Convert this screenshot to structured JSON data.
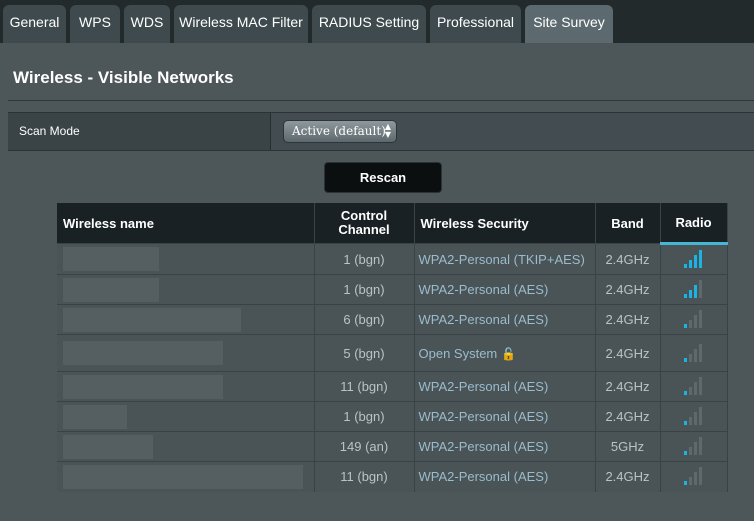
{
  "tabs": [
    {
      "label": "General",
      "active": false
    },
    {
      "label": "WPS",
      "active": false
    },
    {
      "label": "WDS",
      "active": false
    },
    {
      "label": "Wireless MAC Filter",
      "active": false
    },
    {
      "label": "RADIUS Setting",
      "active": false
    },
    {
      "label": "Professional",
      "active": false
    },
    {
      "label": "Site Survey",
      "active": true
    }
  ],
  "page_title": "Wireless - Visible Networks",
  "scan": {
    "label": "Scan Mode",
    "selected": "Active (default)"
  },
  "rescan_label": "Rescan",
  "table": {
    "headers": {
      "name": "Wireless name",
      "channel": "Control Channel",
      "security": "Wireless Security",
      "band": "Band",
      "radio": "Radio"
    },
    "rows": [
      {
        "channel": "1 (bgn)",
        "security": "WPA2-Personal (TKIP+AES)",
        "band": "2.4GHz",
        "signal": 4,
        "locked": false
      },
      {
        "channel": "1 (bgn)",
        "security": "WPA2-Personal (AES)",
        "band": "2.4GHz",
        "signal": 3,
        "locked": false
      },
      {
        "channel": "6 (bgn)",
        "security": "WPA2-Personal (AES)",
        "band": "2.4GHz",
        "signal": 1,
        "locked": false
      },
      {
        "channel": "5 (bgn)",
        "security": "Open System",
        "band": "2.4GHz",
        "signal": 1,
        "locked": true
      },
      {
        "channel": "11 (bgn)",
        "security": "WPA2-Personal (AES)",
        "band": "2.4GHz",
        "signal": 1,
        "locked": false
      },
      {
        "channel": "1 (bgn)",
        "security": "WPA2-Personal (AES)",
        "band": "2.4GHz",
        "signal": 1,
        "locked": false
      },
      {
        "channel": "149 (an)",
        "security": "WPA2-Personal (AES)",
        "band": "5GHz",
        "signal": 1,
        "locked": false
      },
      {
        "channel": "11 (bgn)",
        "security": "WPA2-Personal (AES)",
        "band": "2.4GHz",
        "signal": 1,
        "locked": false
      }
    ]
  },
  "colors": {
    "signal_on": "#1bb3e3",
    "signal_off": "#5f686b",
    "security_text": "#9bbccd"
  }
}
